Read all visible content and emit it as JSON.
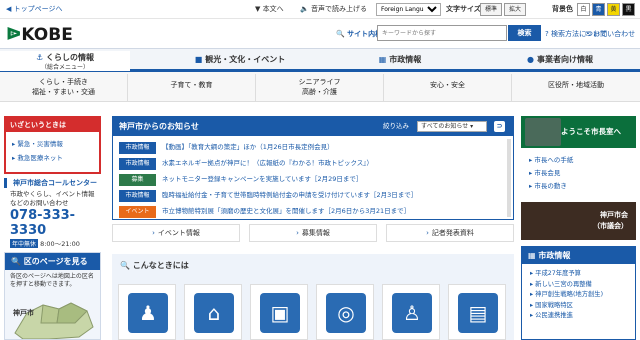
{
  "util": {
    "top": "◀ トップページへ",
    "honbun": "▼ 本文へ",
    "audio": "🔈 音声で読み上げる",
    "lang": "Foreign Languages",
    "fontsize": "文字サイズ",
    "std": "標準",
    "big": "拡大",
    "bgcolor": "背景色",
    "c1": "白",
    "c2": "青",
    "c3": "黄",
    "c4": "黒"
  },
  "header": {
    "logo": "KOBE",
    "logo_mark": "ᐉ",
    "search_label": "サイト内検索",
    "search_placeholder": "キーワードから探す",
    "search_btn": "検索",
    "link1": "? 検索方法について",
    "link2": "✉ お問い合わせ"
  },
  "nav": {
    "life1": "くらしの情報",
    "life2": "（総合メニュー）",
    "tourism": "観光・文化・イベント",
    "city": "市政情報",
    "biz": "事業者向け情報"
  },
  "subnav": [
    [
      "くらし・手続き",
      "福祉・すまい・交通"
    ],
    [
      "子育て・教育",
      ""
    ],
    [
      "シニアライフ",
      "高齢・介護"
    ],
    [
      "安心・安全",
      ""
    ],
    [
      "区役所・地域活動",
      ""
    ]
  ],
  "emergency": {
    "title": "いざというときは",
    "items": [
      "▸ 緊急・災害情報",
      "▸ 救急医療ネット"
    ]
  },
  "callcenter": {
    "title": "神戸市総合コールセンター",
    "desc1": "市政やくらし、イベント情報",
    "desc2": "などのお問い合わせ",
    "number": "078-333-3330",
    "tag": "年中無休",
    "hours": "8:00～21:00"
  },
  "ward": {
    "title": "区のページを見る",
    "desc": "各区のページへは地図上の区名を押すと移動できます。",
    "label": "神戸市"
  },
  "news": {
    "title": "神戸市からのお知らせ",
    "filter_label": "絞り込み",
    "filter_value": "すべてのお知らせ",
    "rss": "⊃",
    "rows": [
      {
        "cat": "市政情報",
        "text": "【動画】「教育大綱の策定」ほか（1月26日市長定例会見）"
      },
      {
        "cat": "市政情報",
        "text": "水素エネルギー拠点が神戸に！（広報紙の『わかる！市政トピックス』）"
      },
      {
        "cat": "募集",
        "text": "ネットモニター登録キャンペーンを実施しています［2月29日まで］"
      },
      {
        "cat": "市政情報",
        "text": "臨時福祉給付金・子育て世帯臨時特例給付金の申請を受け付けています［2月3日まで］"
      },
      {
        "cat": "イベント",
        "text": "市立博物館特別展「須磨の歴史と文化展」を開催します［2月6日から3月21日まで］"
      }
    ]
  },
  "tabs": [
    "イベント情報",
    "募集情報",
    "記者発表資料"
  ],
  "konna": {
    "title": "こんなときには",
    "icons": [
      "person-child",
      "building",
      "briefcase",
      "rings",
      "elder",
      "certificate"
    ]
  },
  "mayor": {
    "title": "ようこそ市長室へ",
    "links": [
      "▸ 市長への手紙",
      "▸ 市長会見",
      "▸ 市長の動き"
    ]
  },
  "council": {
    "line1": "神戸市会",
    "line2": "（市議会）"
  },
  "cityinfo": {
    "title": "市政情報",
    "items": [
      "▸ 平成27年度予算",
      "▸ 新しい三宮の再整備",
      "▸ 神戸創生戦略(地方創生)",
      "▸ 国家戦略特区",
      "▸ 公民連携推進"
    ]
  },
  "colors": {
    "primary": "#1a5aa8",
    "emergency": "#d42d2d",
    "mayor_green": "#0b6f3c",
    "event_orange": "#e86a1a"
  }
}
